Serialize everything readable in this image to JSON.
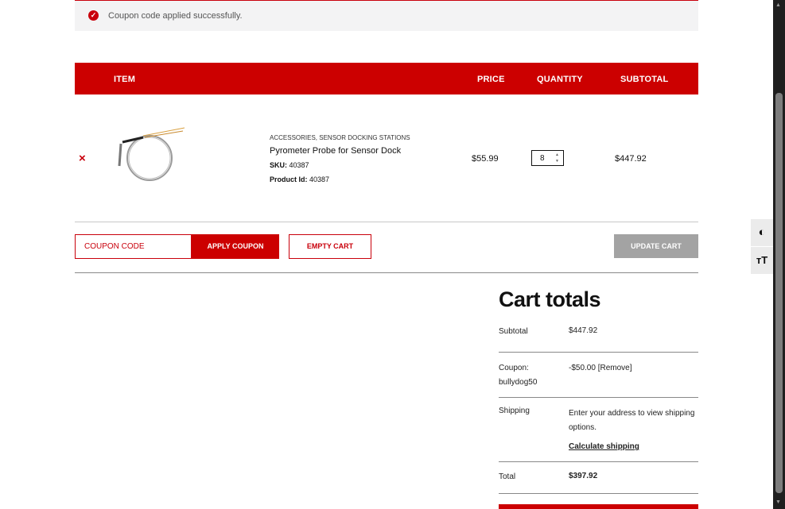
{
  "notice": {
    "message": "Coupon code applied successfully.",
    "icon": "check-circle-icon"
  },
  "table": {
    "headers": {
      "item": "ITEM",
      "price": "PRICE",
      "quantity": "QUANTITY",
      "subtotal": "SUBTOTAL"
    }
  },
  "item": {
    "categories": "ACCESSORIES, SENSOR DOCKING STATIONS",
    "name": "Pyrometer Probe for Sensor Dock",
    "sku_label": "SKU:",
    "sku": "40387",
    "product_id_label": "Product Id:",
    "product_id": "40387",
    "price": "$55.99",
    "quantity": "8",
    "subtotal": "$447.92",
    "remove_symbol": "×"
  },
  "actions": {
    "coupon_placeholder": "COUPON CODE",
    "apply_label": "APPLY COUPON",
    "empty_label": "EMPTY CART",
    "update_label": "UPDATE CART"
  },
  "totals": {
    "title": "Cart totals",
    "subtotal_label": "Subtotal",
    "subtotal_value": "$447.92",
    "coupon_label_line1": "Coupon:",
    "coupon_label_line2": "bullydog50",
    "coupon_value": "-$50.00",
    "coupon_remove": "[Remove]",
    "shipping_label": "Shipping",
    "shipping_text": "Enter your address to view shipping options.",
    "calculate_shipping": "Calculate shipping",
    "total_label": "Total",
    "total_value": "$397.92"
  },
  "colors": {
    "brand_red": "#cc0000",
    "update_gray": "#a3a3a3"
  }
}
